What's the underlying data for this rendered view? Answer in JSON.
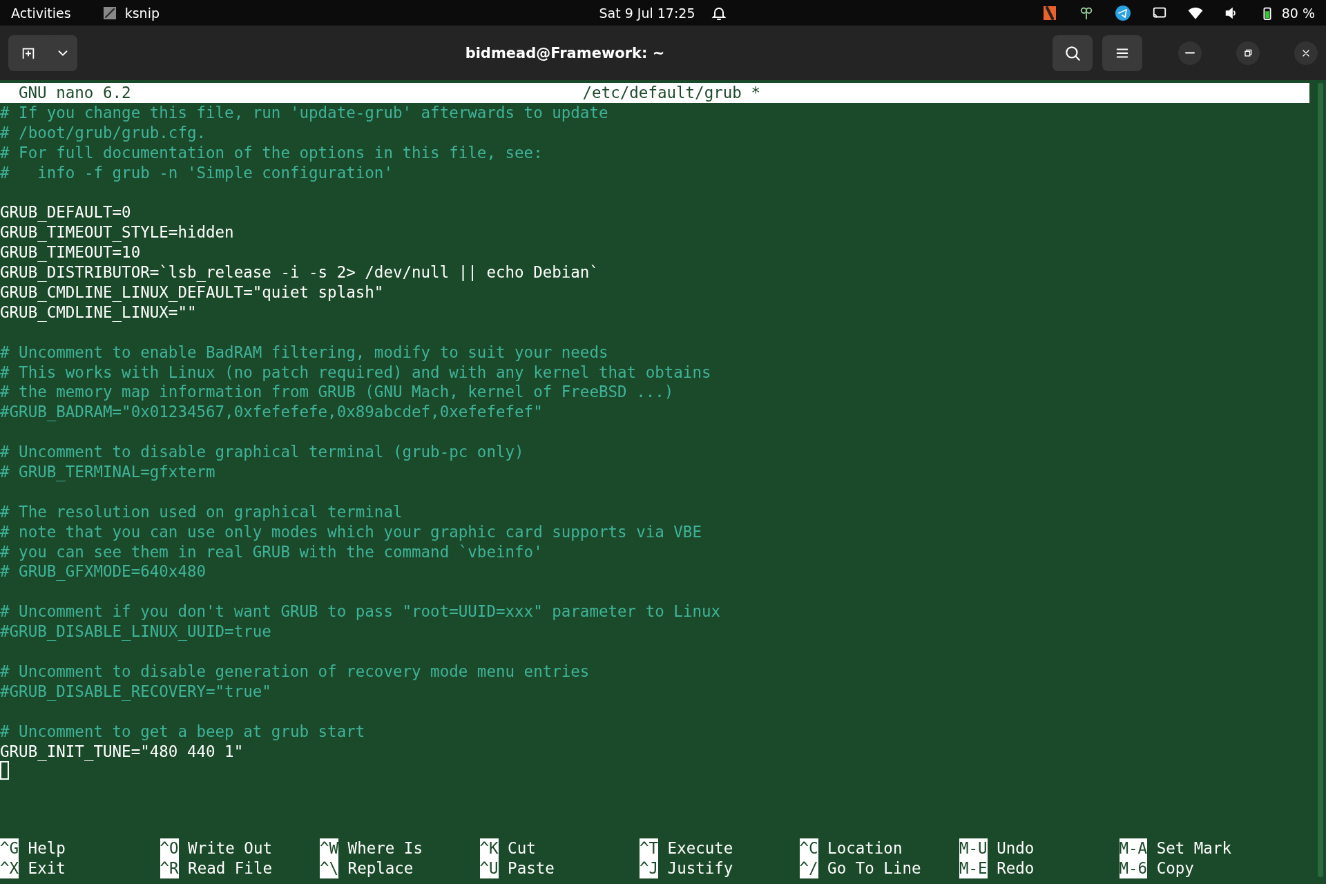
{
  "top_bar": {
    "activities": "Activities",
    "app": "ksnip",
    "clock": "Sat 9 Jul  17:25",
    "battery": "80 %"
  },
  "window": {
    "title": "bidmead@Framework: ~"
  },
  "nano": {
    "version": "GNU nano 6.2",
    "file": "/etc/default/grub *",
    "lines": [
      {
        "kind": "comment",
        "text": "# If you change this file, run 'update-grub' afterwards to update"
      },
      {
        "kind": "comment",
        "text": "# /boot/grub/grub.cfg."
      },
      {
        "kind": "comment",
        "text": "# For full documentation of the options in this file, see:"
      },
      {
        "kind": "comment",
        "text": "#   info -f grub -n 'Simple configuration'"
      },
      {
        "kind": "blank"
      },
      {
        "kind": "code",
        "text": "GRUB_DEFAULT=0"
      },
      {
        "kind": "code",
        "text": "GRUB_TIMEOUT_STYLE=hidden"
      },
      {
        "kind": "code",
        "text": "GRUB_TIMEOUT=10"
      },
      {
        "kind": "code",
        "text": "GRUB_DISTRIBUTOR=`lsb_release -i -s 2> /dev/null || echo Debian`"
      },
      {
        "kind": "code",
        "text": "GRUB_CMDLINE_LINUX_DEFAULT=\"quiet splash\""
      },
      {
        "kind": "code",
        "text": "GRUB_CMDLINE_LINUX=\"\""
      },
      {
        "kind": "blank"
      },
      {
        "kind": "comment",
        "text": "# Uncomment to enable BadRAM filtering, modify to suit your needs"
      },
      {
        "kind": "comment",
        "text": "# This works with Linux (no patch required) and with any kernel that obtains"
      },
      {
        "kind": "comment",
        "text": "# the memory map information from GRUB (GNU Mach, kernel of FreeBSD ...)"
      },
      {
        "kind": "comment",
        "text": "#GRUB_BADRAM=\"0x01234567,0xfefefefe,0x89abcdef,0xefefefef\""
      },
      {
        "kind": "blank"
      },
      {
        "kind": "comment",
        "text": "# Uncomment to disable graphical terminal (grub-pc only)"
      },
      {
        "kind": "comment",
        "text": "# GRUB_TERMINAL=gfxterm"
      },
      {
        "kind": "blank"
      },
      {
        "kind": "comment",
        "text": "# The resolution used on graphical terminal"
      },
      {
        "kind": "comment",
        "text": "# note that you can use only modes which your graphic card supports via VBE"
      },
      {
        "kind": "comment",
        "text": "# you can see them in real GRUB with the command `vbeinfo'"
      },
      {
        "kind": "comment",
        "text": "# GRUB_GFXMODE=640x480"
      },
      {
        "kind": "blank"
      },
      {
        "kind": "comment",
        "text": "# Uncomment if you don't want GRUB to pass \"root=UUID=xxx\" parameter to Linux"
      },
      {
        "kind": "comment",
        "text": "#GRUB_DISABLE_LINUX_UUID=true"
      },
      {
        "kind": "blank"
      },
      {
        "kind": "comment",
        "text": "# Uncomment to disable generation of recovery mode menu entries"
      },
      {
        "kind": "comment",
        "text": "#GRUB_DISABLE_RECOVERY=\"true\""
      },
      {
        "kind": "blank"
      },
      {
        "kind": "comment",
        "text": "# Uncomment to get a beep at grub start"
      },
      {
        "kind": "code",
        "text": "GRUB_INIT_TUNE=\"480 440 1\""
      }
    ],
    "shortcuts": [
      {
        "key": "^G",
        "label": "Help"
      },
      {
        "key": "^O",
        "label": "Write Out"
      },
      {
        "key": "^W",
        "label": "Where Is"
      },
      {
        "key": "^K",
        "label": "Cut"
      },
      {
        "key": "^T",
        "label": "Execute"
      },
      {
        "key": "^C",
        "label": "Location"
      },
      {
        "key": "M-U",
        "label": "Undo"
      },
      {
        "key": "M-A",
        "label": "Set Mark"
      },
      {
        "key": "^X",
        "label": "Exit"
      },
      {
        "key": "^R",
        "label": "Read File"
      },
      {
        "key": "^\\",
        "label": "Replace"
      },
      {
        "key": "^U",
        "label": "Paste"
      },
      {
        "key": "^J",
        "label": "Justify"
      },
      {
        "key": "^/",
        "label": "Go To Line"
      },
      {
        "key": "M-E",
        "label": "Redo"
      },
      {
        "key": "M-6",
        "label": "Copy"
      }
    ]
  }
}
